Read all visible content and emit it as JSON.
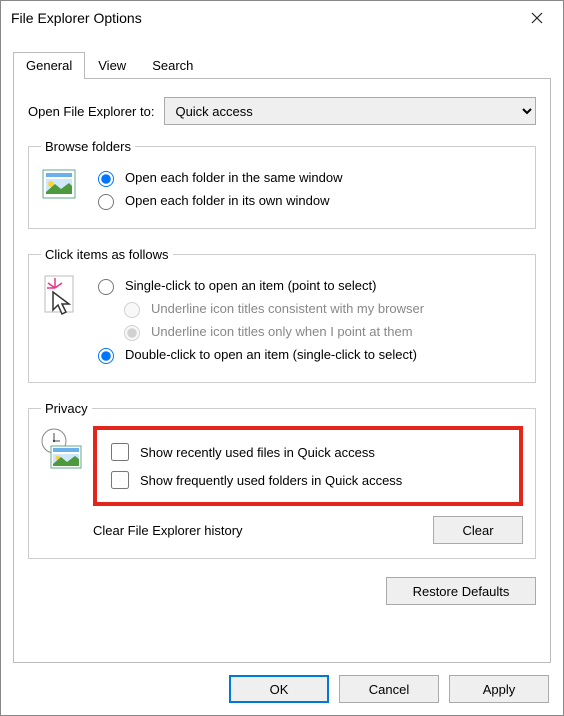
{
  "title": "File Explorer Options",
  "tabs": {
    "general": "General",
    "view": "View",
    "search": "Search"
  },
  "open_to_label": "Open File Explorer to:",
  "open_to_value": "Quick access",
  "browse": {
    "legend": "Browse folders",
    "same": "Open each folder in the same window",
    "own": "Open each folder in its own window"
  },
  "click": {
    "legend": "Click items as follows",
    "single": "Single-click to open an item (point to select)",
    "consistent": "Underline icon titles consistent with my browser",
    "point": "Underline icon titles only when I point at them",
    "double": "Double-click to open an item (single-click to select)"
  },
  "privacy": {
    "legend": "Privacy",
    "recent": "Show recently used files in Quick access",
    "frequent": "Show frequently used folders in Quick access",
    "clear_label": "Clear File Explorer history",
    "clear_btn": "Clear"
  },
  "restore": "Restore Defaults",
  "buttons": {
    "ok": "OK",
    "cancel": "Cancel",
    "apply": "Apply"
  }
}
